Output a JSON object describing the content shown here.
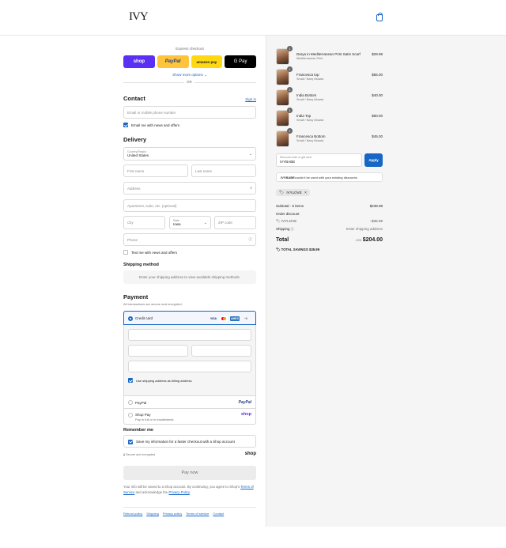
{
  "header": {
    "logo": "IVY",
    "cart_icon": "shopping-bag-icon"
  },
  "express": {
    "label": "Express checkout",
    "buttons": [
      "shop",
      "PayPal",
      "amazon pay",
      "G Pay"
    ],
    "show_more": "Show more options ⌄",
    "or": "OR"
  },
  "contact": {
    "title": "Contact",
    "sign_in": "Sign in",
    "email_placeholder": "Email or mobile phone number",
    "newsletter": "Email me with news and offers"
  },
  "delivery": {
    "title": "Delivery",
    "country_label": "Country/Region",
    "country_value": "United States",
    "first_name": "First name",
    "last_name": "Last name",
    "address": "Address",
    "apartment": "Apartment, suite, etc. (optional)",
    "city": "City",
    "state_label": "State",
    "state_value": "Iowa",
    "zip": "ZIP code",
    "phone": "Phone",
    "text_offers": "Text me with news and offers"
  },
  "shipping_method": {
    "title": "Shipping method",
    "notice": "Enter your shipping address to view available shipping methods."
  },
  "payment": {
    "title": "Payment",
    "subtitle": "All transactions are secure and encrypted.",
    "credit_card": "Credit card",
    "card_icons": [
      "VISA",
      "MC",
      "AMEX",
      "+5"
    ],
    "billing_same": "Use shipping address as billing address",
    "paypal": "PayPal",
    "paypal_logo": "PayPal",
    "shop_pay": "Shop Pay",
    "shop_pay_sub": "Pay in full or in installments",
    "shop_pay_logo": "shop"
  },
  "remember": {
    "title": "Remember me",
    "save_info": "Save my information for a faster checkout with a Shop account",
    "secure": "Secure and encrypted",
    "shop_logo": "shop"
  },
  "pay_now": "Pay now",
  "legal": {
    "text_before": "Your info will be saved to a Shop account. By continuing, you agree to Shop's",
    "terms": "Terms of Service",
    "and": "and acknowledge the",
    "privacy": "Privacy Policy",
    "end": "."
  },
  "footer_links": [
    "Refund policy",
    "Shipping",
    "Privacy policy",
    "Terms of service",
    "Contact"
  ],
  "order": {
    "items": [
      {
        "qty": "1",
        "name": "Darya in Mediterranean Print Satin Scarf",
        "variant": "Mediterranean Print",
        "price": "$29.99"
      },
      {
        "qty": "1",
        "name": "Francesca top",
        "variant": "Small / Navy Mosaic",
        "price": "$65.00"
      },
      {
        "qty": "1",
        "name": "India Bottom",
        "variant": "Small / Navy Mosaic",
        "price": "$40.00"
      },
      {
        "qty": "1",
        "name": "India Top",
        "variant": "Small / Navy Mosaic",
        "price": "$60.00"
      },
      {
        "qty": "1",
        "name": "Francesca Bottom",
        "variant": "Small / Navy Mosaic",
        "price": "$45.00"
      }
    ],
    "discount_label": "Discount code or gift card",
    "discount_value": "IVYBABE",
    "apply": "Apply",
    "error_code": "IVYBABE",
    "error_text": " couldn't be used with your existing discounts.",
    "applied_tag": "IVYLOVE",
    "subtotal_label": "Subtotal · 5 items",
    "subtotal_value": "$239.99",
    "order_discount_label": "Order discount",
    "code_label": "IVYLOVE",
    "code_value": "−$35.99",
    "shipping_label": "Shipping",
    "shipping_value": "Enter shipping address",
    "total_label": "Total",
    "currency": "USD",
    "total_value": "$204.00",
    "savings_label": "TOTAL SAVINGS",
    "savings_value": "$35.99"
  },
  "colors": {
    "accent": "#1666c5",
    "shop_purple": "#5a31f4",
    "paypal_yellow": "#ffc439",
    "amazon_yellow": "#ffd814"
  }
}
